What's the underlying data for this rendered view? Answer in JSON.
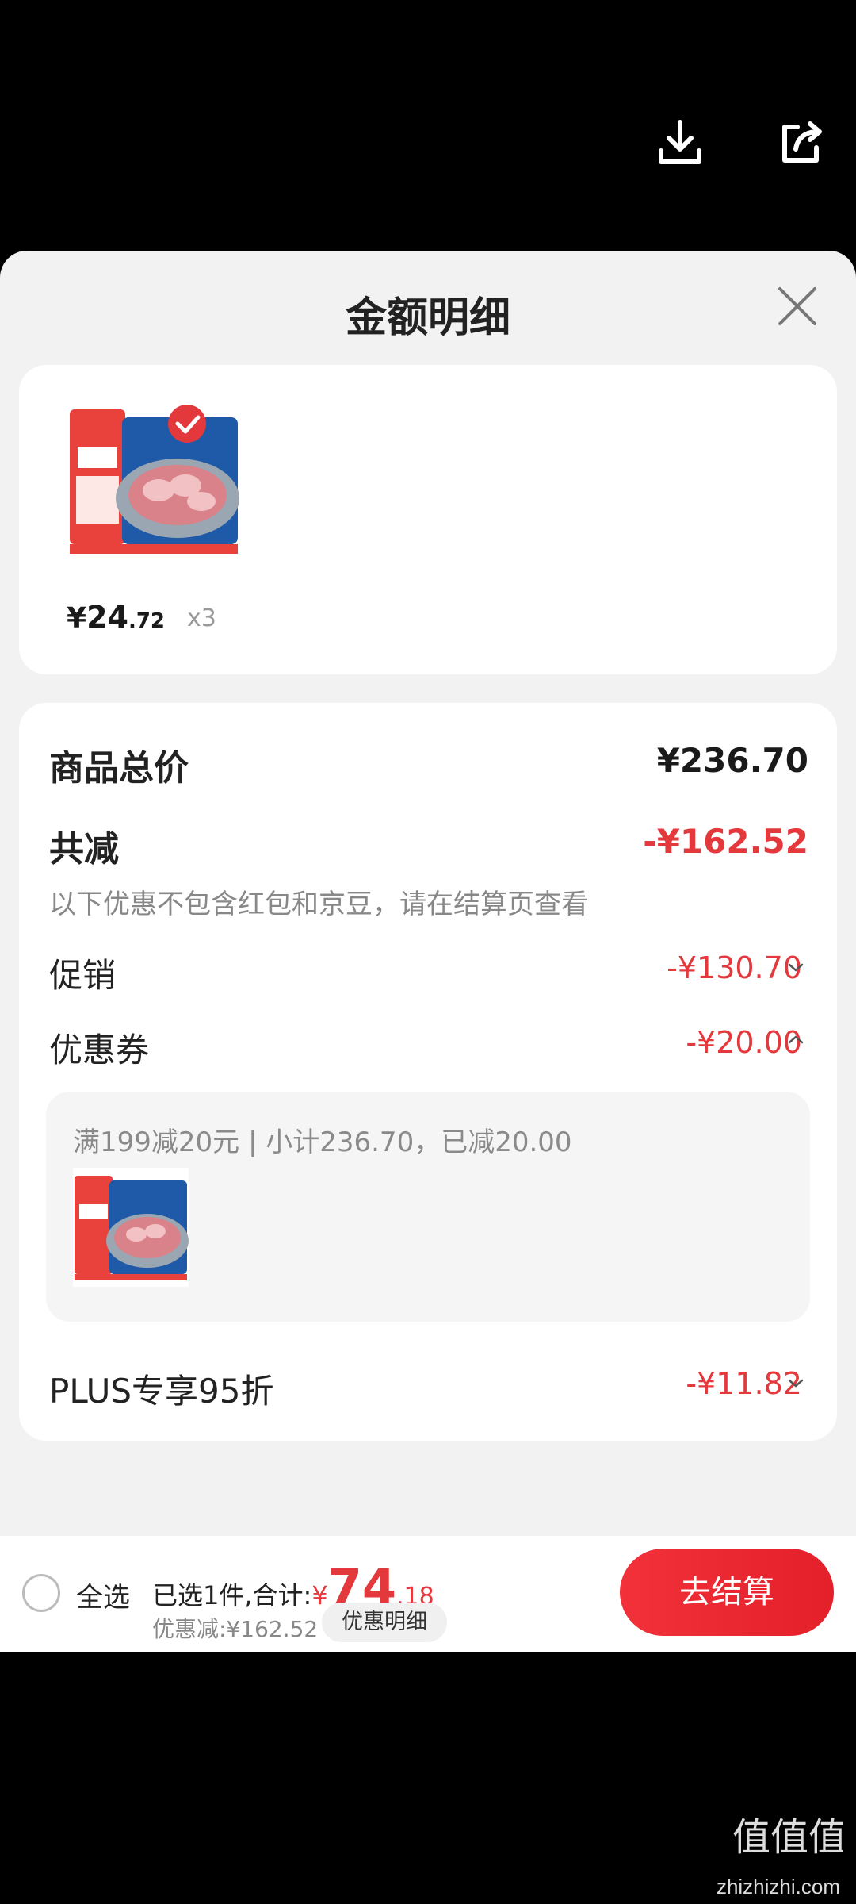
{
  "header": {
    "download_icon": "download-icon",
    "share_icon": "share-icon"
  },
  "sheet": {
    "title": "金额明细",
    "close_icon": "close-icon"
  },
  "product": {
    "price_symbol": "¥",
    "price_int": "24",
    "price_dec": ".72",
    "quantity": "x3"
  },
  "breakdown": {
    "total_label": "商品总价",
    "total_value": "¥236.70",
    "reduce_label": "共减",
    "reduce_value": "-¥162.52",
    "reduce_note": "以下优惠不包含红包和京豆，请在结算页查看",
    "promo_label": "促销",
    "promo_value": "-¥130.70",
    "coupon_label": "优惠券",
    "coupon_value": "-¥20.00",
    "coupon_detail": "满199减20元 | 小计236.70，已减20.00",
    "plus_label": "PLUS专享95折",
    "plus_value": "-¥11.82"
  },
  "footer": {
    "select_all": "全选",
    "selected_prefix": "已选1件,合计:",
    "total_symbol": "¥",
    "total_int": "74",
    "total_dec": ".18",
    "discount_text": "优惠减:¥162.52",
    "detail_button": "优惠明细",
    "checkout_button": "去结算"
  },
  "watermark": {
    "text": "zhizhizhi.com"
  },
  "colors": {
    "accent_red": "#e4393c",
    "sheet_bg": "#f2f2f2"
  }
}
